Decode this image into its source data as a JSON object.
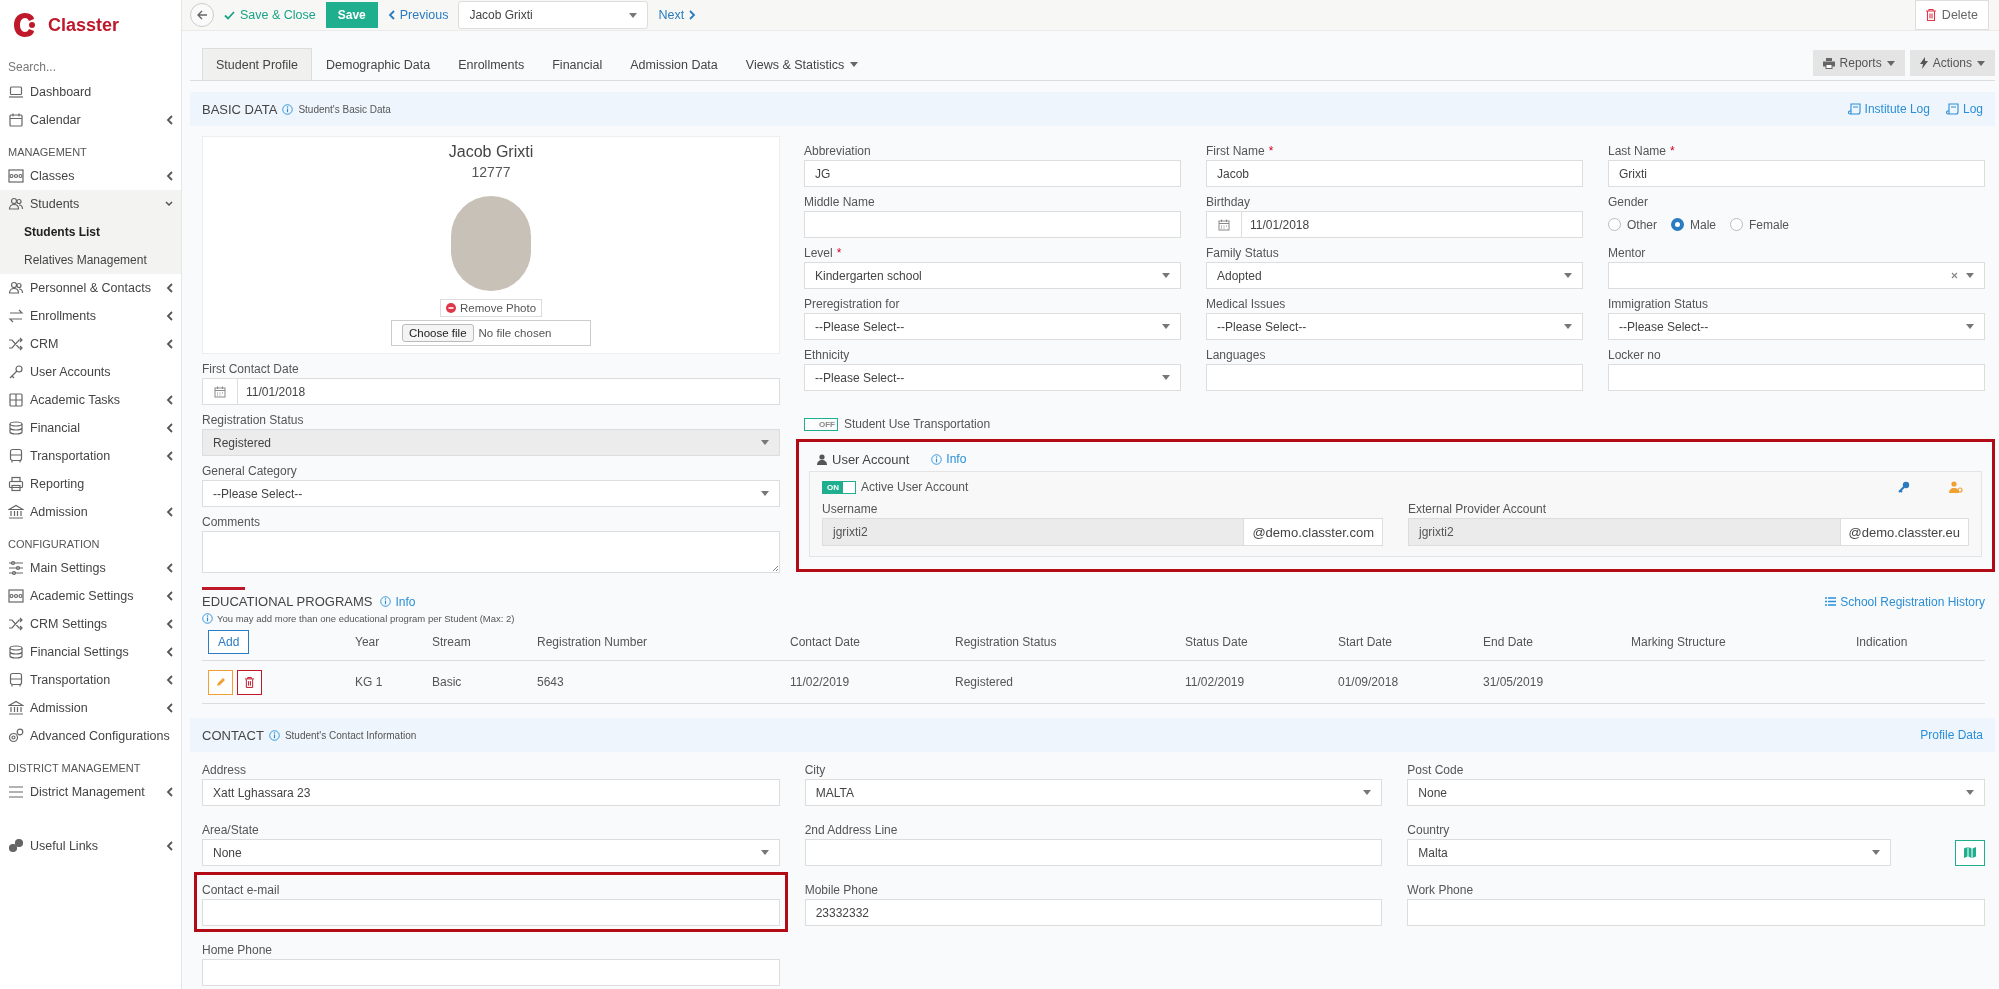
{
  "brand": {
    "name": "Classter"
  },
  "sidebar": {
    "search_placeholder": "Search...",
    "groups": [
      {
        "items": [
          {
            "label": "Dashboard",
            "expandable": false,
            "expanded": false
          },
          {
            "label": "Calendar",
            "expandable": true,
            "expanded": false
          }
        ]
      },
      {
        "heading": "MANAGEMENT",
        "items": [
          {
            "label": "Classes",
            "expandable": true,
            "expanded": false
          },
          {
            "label": "Students",
            "expandable": true,
            "expanded": true,
            "children": [
              {
                "label": "Students List",
                "selected": true
              },
              {
                "label": "Relatives Management",
                "selected": false
              }
            ]
          },
          {
            "label": "Personnel & Contacts",
            "expandable": true,
            "expanded": false
          },
          {
            "label": "Enrollments",
            "expandable": true,
            "expanded": false
          },
          {
            "label": "CRM",
            "expandable": true,
            "expanded": false
          },
          {
            "label": "User Accounts",
            "expandable": false,
            "expanded": false
          },
          {
            "label": "Academic Tasks",
            "expandable": true,
            "expanded": false
          },
          {
            "label": "Financial",
            "expandable": true,
            "expanded": false
          },
          {
            "label": "Transportation",
            "expandable": true,
            "expanded": false
          },
          {
            "label": "Reporting",
            "expandable": false,
            "expanded": false
          },
          {
            "label": "Admission",
            "expandable": true,
            "expanded": false
          }
        ]
      },
      {
        "heading": "CONFIGURATION",
        "items": [
          {
            "label": "Main Settings",
            "expandable": true,
            "expanded": false
          },
          {
            "label": "Academic Settings",
            "expandable": true,
            "expanded": false
          },
          {
            "label": "CRM Settings",
            "expandable": true,
            "expanded": false
          },
          {
            "label": "Financial Settings",
            "expandable": true,
            "expanded": false
          },
          {
            "label": "Transportation",
            "expandable": true,
            "expanded": false
          },
          {
            "label": "Admission",
            "expandable": true,
            "expanded": false
          },
          {
            "label": "Advanced Configurations",
            "expandable": false,
            "expanded": false
          }
        ]
      },
      {
        "heading": "DISTRICT MANAGEMENT",
        "items": [
          {
            "label": "District Management",
            "expandable": true,
            "expanded": false
          }
        ]
      },
      {
        "items": [
          {
            "label": "Useful Links",
            "expandable": true,
            "expanded": false
          }
        ]
      }
    ]
  },
  "toolbar": {
    "save_close": "Save & Close",
    "save": "Save",
    "previous": "Previous",
    "student_select": "Jacob Grixti",
    "next": "Next",
    "delete": "Delete"
  },
  "tabs": [
    {
      "label": "Student Profile",
      "selected": true,
      "dropdown": false
    },
    {
      "label": "Demographic Data",
      "selected": false,
      "dropdown": false
    },
    {
      "label": "Enrollments",
      "selected": false,
      "dropdown": false
    },
    {
      "label": "Financial",
      "selected": false,
      "dropdown": false
    },
    {
      "label": "Admission Data",
      "selected": false,
      "dropdown": false
    },
    {
      "label": "Views & Statistics",
      "selected": false,
      "dropdown": true
    }
  ],
  "tab_actions": [
    "Reports",
    "Actions"
  ],
  "basic_data": {
    "title": "BASIC DATA",
    "subtitle": "Student's Basic Data",
    "links": [
      "Institute Log",
      "Log"
    ],
    "profile": {
      "name": "Jacob Grixti",
      "id": "12777",
      "remove_photo": "Remove Photo",
      "file_button": "Choose file",
      "file_status": "No file chosen"
    },
    "left_fields": [
      {
        "label": "First Contact Date",
        "kind": "date",
        "value": "11/01/2018"
      },
      {
        "label": "Registration Status",
        "kind": "select",
        "value": "Registered",
        "disabled": true
      },
      {
        "label": "General Category",
        "kind": "select",
        "value": "--Please Select--",
        "disabled": false
      },
      {
        "label": "Comments",
        "kind": "textarea"
      }
    ],
    "fields": [
      {
        "label": "Abbreviation",
        "kind": "text",
        "value": "JG"
      },
      {
        "label": "First Name",
        "required_mark": "*",
        "kind": "text",
        "value": "Jacob"
      },
      {
        "label": "Last Name",
        "required_mark": "*",
        "kind": "text",
        "value": "Grixti"
      },
      {
        "label": "Middle Name",
        "kind": "text"
      },
      {
        "label": "Birthday",
        "kind": "date",
        "value": "11/01/2018"
      },
      {
        "label": "Gender",
        "kind": "radio",
        "options": [
          {
            "label": "Other",
            "selected": false
          },
          {
            "label": "Male",
            "selected": true
          },
          {
            "label": "Female",
            "selected": false
          }
        ]
      },
      {
        "label": "Level",
        "required_mark": "*",
        "kind": "select",
        "value": "Kindergarten school",
        "disabled": false
      },
      {
        "label": "Family Status",
        "kind": "select",
        "value": "Adopted",
        "disabled": false
      },
      {
        "label": "Mentor",
        "kind": "clearable",
        "disabled": false
      },
      {
        "label": "Preregistration for",
        "kind": "select",
        "value": "--Please Select--",
        "disabled": false
      },
      {
        "label": "Medical Issues",
        "kind": "select",
        "value": "--Please Select--",
        "disabled": false
      },
      {
        "label": "Immigration Status",
        "kind": "select",
        "value": "--Please Select--",
        "disabled": false
      },
      {
        "label": "Ethnicity",
        "kind": "select",
        "value": "--Please Select--",
        "disabled": false
      },
      {
        "label": "Languages",
        "kind": "text"
      },
      {
        "label": "Locker no",
        "kind": "text"
      }
    ],
    "transportation": {
      "label": "Student Use Transportation",
      "on": false,
      "state_text": "OFF"
    },
    "user_account": {
      "title": "User Account",
      "info": "Info",
      "highlighted": true,
      "active": {
        "label": "Active User Account",
        "on": true,
        "state_text": "ON"
      },
      "fields": [
        {
          "label": "Username",
          "value": "jgrixti2",
          "suffix": "@demo.classter.com"
        },
        {
          "label": "External Provider Account",
          "value": "jgrixti2",
          "suffix": "@demo.classter.eu"
        }
      ]
    }
  },
  "educational_programs": {
    "title": "EDUCATIONAL PROGRAMS",
    "info": "Info",
    "note": "You may add more than one educational program per Student (Max: 2)",
    "history_link": "School Registration History",
    "add_button": "Add",
    "columns": [
      "Year",
      "Stream",
      "Registration Number",
      "Contact Date",
      "Registration Status",
      "Status Date",
      "Start Date",
      "End Date",
      "Marking Structure",
      "Indication"
    ],
    "rows": [
      {
        "cells": [
          "KG 1",
          "Basic",
          "5643",
          "11/02/2019",
          "Registered",
          "11/02/2019",
          "01/09/2018",
          "31/05/2019"
        ]
      }
    ]
  },
  "contact": {
    "title": "CONTACT",
    "subtitle": "Student's Contact Information",
    "link": "Profile Data",
    "fields": [
      {
        "label": "Address",
        "kind": "text",
        "value": "Xatt Lghassara 23",
        "highlighted": false
      },
      {
        "label": "City",
        "kind": "select",
        "value": "MALTA",
        "disabled": false,
        "highlighted": false
      },
      {
        "label": "Post Code",
        "kind": "select",
        "value": "None",
        "disabled": false,
        "highlighted": false
      },
      {
        "label": "Area/State",
        "kind": "select",
        "value": "None",
        "disabled": false,
        "highlighted": false
      },
      {
        "label": "2nd Address Line",
        "kind": "text",
        "highlighted": false
      },
      {
        "label": "Country",
        "kind": "select-map",
        "value": "Malta",
        "disabled": false,
        "highlighted": false
      },
      {
        "label": "Contact e-mail",
        "kind": "text",
        "highlighted": true
      },
      {
        "label": "Mobile Phone",
        "kind": "text",
        "value": "23332332",
        "highlighted": false
      },
      {
        "label": "Work Phone",
        "kind": "text",
        "highlighted": false
      },
      {
        "label": "Home Phone",
        "kind": "text",
        "highlighted": false
      }
    ]
  }
}
